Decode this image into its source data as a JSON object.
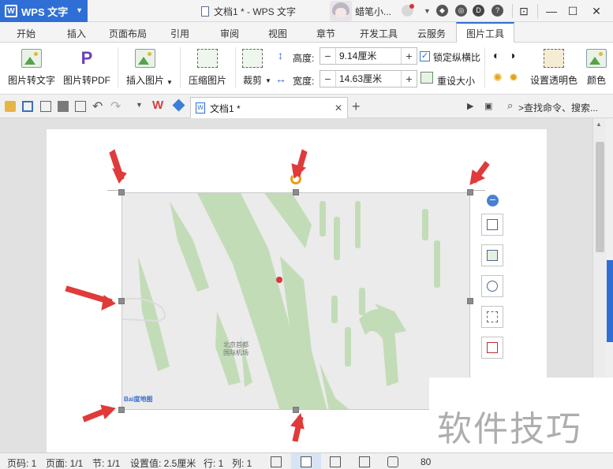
{
  "window": {
    "app_name": "WPS 文字",
    "title": "文档1 * - WPS 文字",
    "user_name": "蜡笔小...",
    "minimize": "—",
    "maximize": "☐",
    "close": "✕"
  },
  "ribbon_tabs": [
    "开始",
    "插入",
    "页面布局",
    "引用",
    "审阅",
    "视图",
    "章节",
    "开发工具",
    "云服务",
    "图片工具"
  ],
  "active_tab": "图片工具",
  "ribbon": {
    "pic_to_text": "图片转文字",
    "pic_to_pdf": "图片转PDF",
    "insert_pic": "插入图片",
    "compress_pic": "压缩图片",
    "crop": "裁剪",
    "height_label": "高度:",
    "height_value": "9.14厘米",
    "width_label": "宽度:",
    "width_value": "14.63厘米",
    "lock_ratio": "锁定纵横比",
    "lock_ratio_checked": true,
    "reset_size": "重设大小",
    "set_transparent": "设置透明色",
    "color_partial": "颜色"
  },
  "quickbar": {
    "doc_tab_name": "文档1 *",
    "new_tab": "+",
    "search_placeholder": ">查找命令、搜索..."
  },
  "image": {
    "map_label_line1": "北京首都",
    "map_label_line2": "国际机场",
    "map_logo": "Bai度地图"
  },
  "watermark": "软件技巧",
  "statusbar": {
    "page_code": "页码: 1",
    "page": "页面: 1/1",
    "section": "节: 1/1",
    "setting": "设置值: 2.5厘米",
    "row": "行: 1",
    "col": "列: 1",
    "zoom_partial": "80"
  },
  "colors": {
    "accent": "#2f6fd5",
    "arrow": "#e03a3a",
    "map_green": "#c3dcb8",
    "map_bg": "#ebebeb",
    "map_pin": "#d33a3a",
    "handle": "#8c8c8c"
  }
}
